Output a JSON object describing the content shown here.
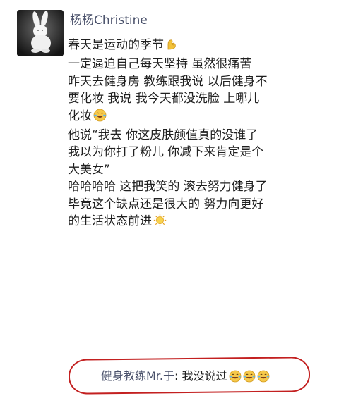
{
  "post": {
    "author": "杨杨Christine",
    "lines": [
      "春天是运动的季节",
      "一定逼迫自己每天坚持 虽然很痛苦",
      "昨天去健身房 教练跟我说 以后健身不",
      "要化妆 我说 我今天都没洗脸 上哪儿",
      "化妆",
      "他说“我去 你这皮肤颜值真的没谁了",
      "我以为你打了粉儿 你减下来肯定是个",
      "大美女”",
      "哈哈哈哈 这把我笑的 滚去努力健身了",
      " 毕竟这个缺点还是很大的 努力向更好",
      "的生活状态前进"
    ],
    "emojis": {
      "line1": "flexed-biceps-icon",
      "line5": "laughing-tears-icon",
      "line11": "sun-icon"
    }
  },
  "comment": {
    "author": "健身教练Mr.于",
    "separator": ": ",
    "text": "我没说过",
    "emojis": [
      "grinning-face-icon",
      "grinning-face-icon",
      "grinning-face-icon"
    ]
  },
  "colors": {
    "name": "#49506a",
    "text": "#202020",
    "annotation": "#c32020"
  }
}
